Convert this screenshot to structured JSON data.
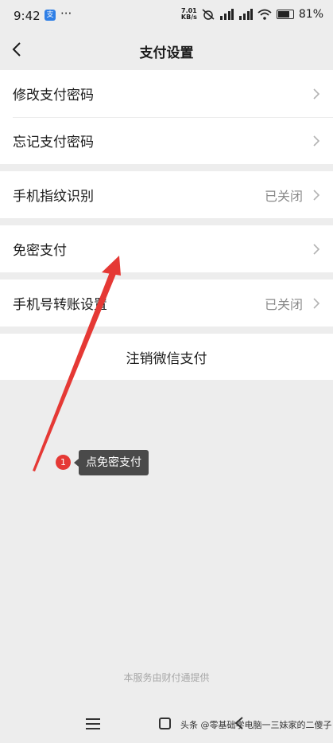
{
  "status_bar": {
    "time": "9:42",
    "app_badge": "支",
    "dots": "···",
    "network_speed": "7.01\nKB/s",
    "battery": "81%"
  },
  "header": {
    "title": "支付设置"
  },
  "groups": [
    {
      "items": [
        {
          "label": "修改支付密码"
        },
        {
          "label": "忘记支付密码"
        }
      ]
    },
    {
      "items": [
        {
          "label": "手机指纹识别",
          "value": "已关闭"
        }
      ]
    },
    {
      "items": [
        {
          "label": "免密支付"
        }
      ]
    },
    {
      "items": [
        {
          "label": "手机号转账设置",
          "value": "已关闭"
        }
      ]
    }
  ],
  "cancel_button": {
    "label": "注销微信支付"
  },
  "annotation": {
    "step_number": "1",
    "text": "点免密支付",
    "color": "#e53935"
  },
  "footer": {
    "note": "本服务由财付通提供"
  },
  "watermark": {
    "text": "头条 @零基础学电脑一三妹家的二傻子"
  }
}
